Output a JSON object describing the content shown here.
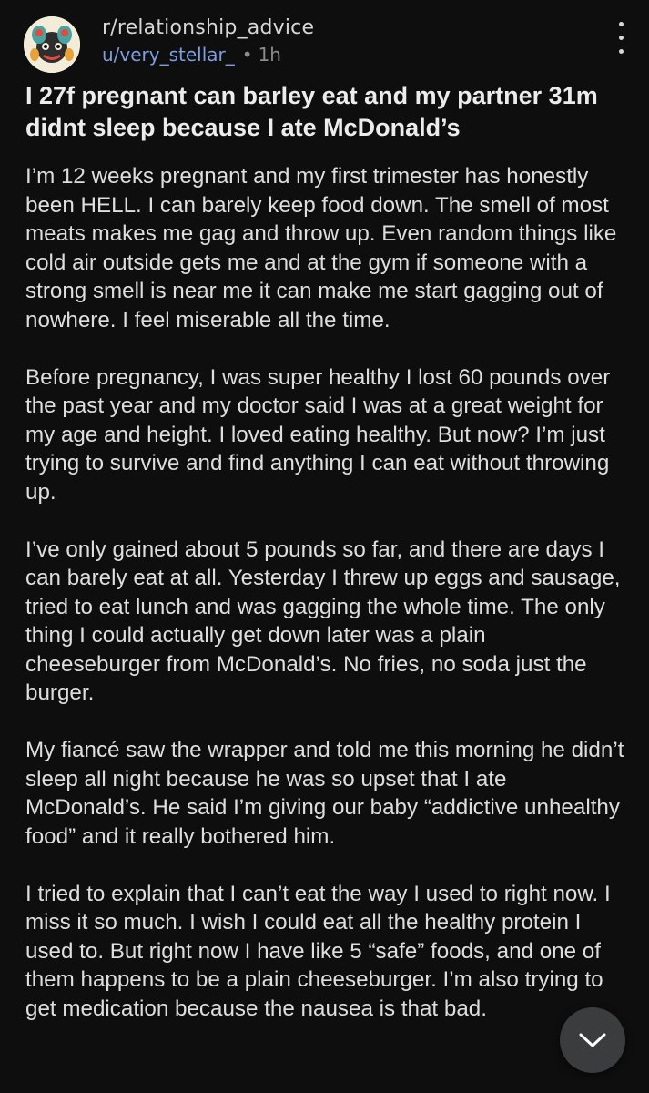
{
  "post": {
    "subreddit": "r/relationship_advice",
    "author": "u/very_stellar_",
    "separator": "•",
    "time_ago": "1h",
    "title": "I 27f pregnant can barley eat and my partner 31m didnt sleep because I ate McDonald’s",
    "paragraphs": [
      "I’m 12 weeks pregnant and my first trimester has honestly been HELL. I can barely keep food down. The smell of most meats makes me gag and throw up. Even random things like cold air outside gets me and at the gym if someone with a strong smell is near me it can make me start gagging out of nowhere. I feel miserable all the time.",
      "Before pregnancy, I was super healthy  I lost 60 pounds over the past year and my doctor said I was at a great weight for my age and height. I loved eating healthy. But now? I’m just trying to survive and find anything I can eat without throwing up.",
      "I’ve only gained about 5 pounds so far, and there are days I can barely eat at all. Yesterday I threw up eggs and sausage, tried to eat lunch and was gagging the whole time. The only thing I could actually get down later was a plain cheeseburger from McDonald’s. No fries, no soda just the burger.",
      "My fiancé saw the wrapper and told me this morning he didn’t sleep all night because he was so upset that I ate McDonald’s. He said I’m giving our baby “addictive unhealthy food” and it really bothered him.",
      "I tried to explain that I can’t eat the way I used to right now. I miss it so much. I wish I could eat all the healthy protein I used to. But right now I have like 5 “safe” foods, and one of them happens to be a plain cheeseburger. I’m also trying to get medication because the nausea is that bad."
    ]
  },
  "icons": {
    "avatar": "subreddit-avatar-icon",
    "more": "more-vertical-icon",
    "scroll": "chevron-down-icon"
  },
  "colors": {
    "background": "#0e0e0e",
    "username": "#7f9de0",
    "meta": "#8c8c8c",
    "scroll_button": "#3a3c3e"
  }
}
